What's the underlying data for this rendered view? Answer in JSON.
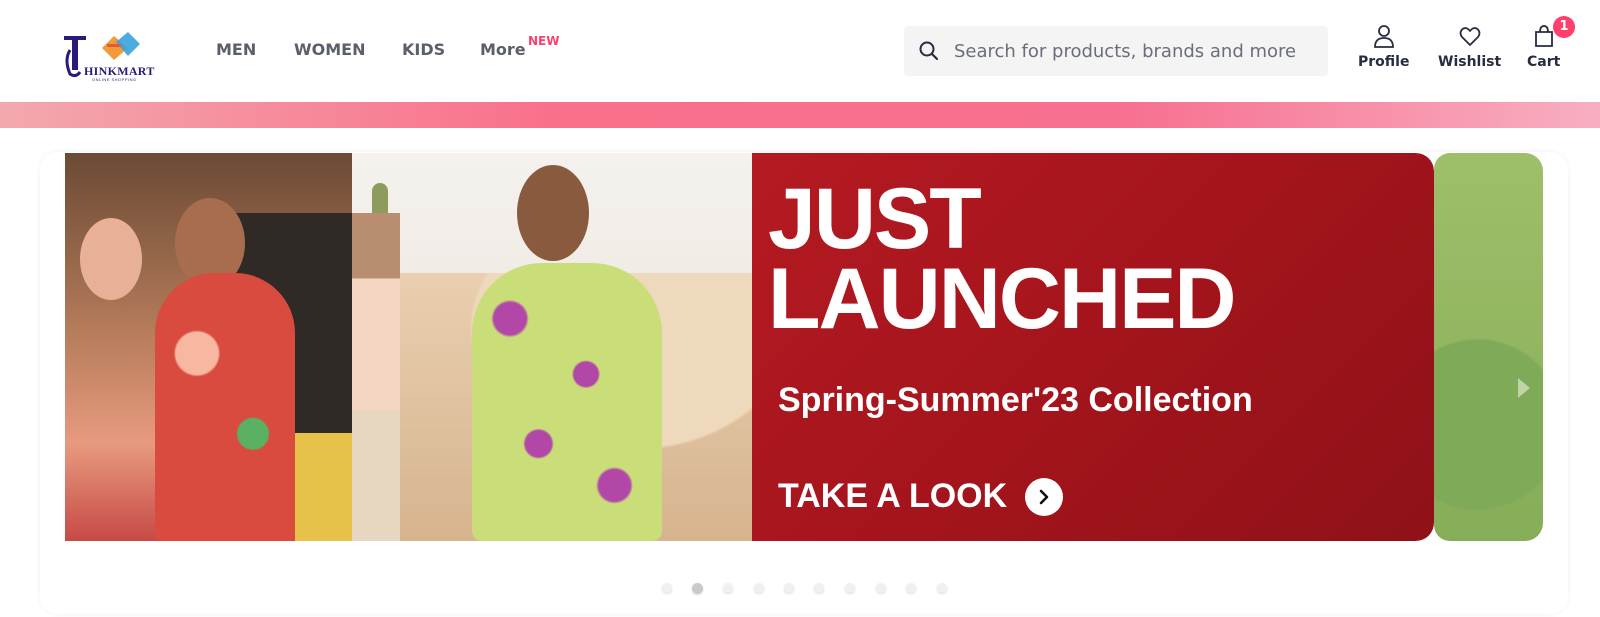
{
  "brand": {
    "logo_text": "HINKMART",
    "logo_tagline": "ONLINE SHOPPING",
    "colors": {
      "primary": "#2a1a7a",
      "accent": "#ff3f6c"
    }
  },
  "nav": {
    "items": [
      {
        "label": "MEN"
      },
      {
        "label": "WOMEN"
      },
      {
        "label": "KIDS"
      },
      {
        "label": "More",
        "badge": "NEW"
      }
    ]
  },
  "search": {
    "placeholder": "Search for products, brands and more",
    "value": "",
    "icon": "search-icon"
  },
  "actions": {
    "profile": {
      "label": "Profile",
      "icon": "user-icon"
    },
    "wishlist": {
      "label": "Wishlist",
      "icon": "heart-icon"
    },
    "cart": {
      "label": "Cart",
      "icon": "bag-icon",
      "count": "1"
    }
  },
  "banner": {
    "title_line1": "JUST",
    "title_line2": "LAUNCHED",
    "subtitle": "Spring-Summer'23 Collection",
    "cta": "TAKE A LOOK",
    "background": "#a4141c"
  },
  "carousel": {
    "total_slides": 10,
    "active_index": 1
  }
}
